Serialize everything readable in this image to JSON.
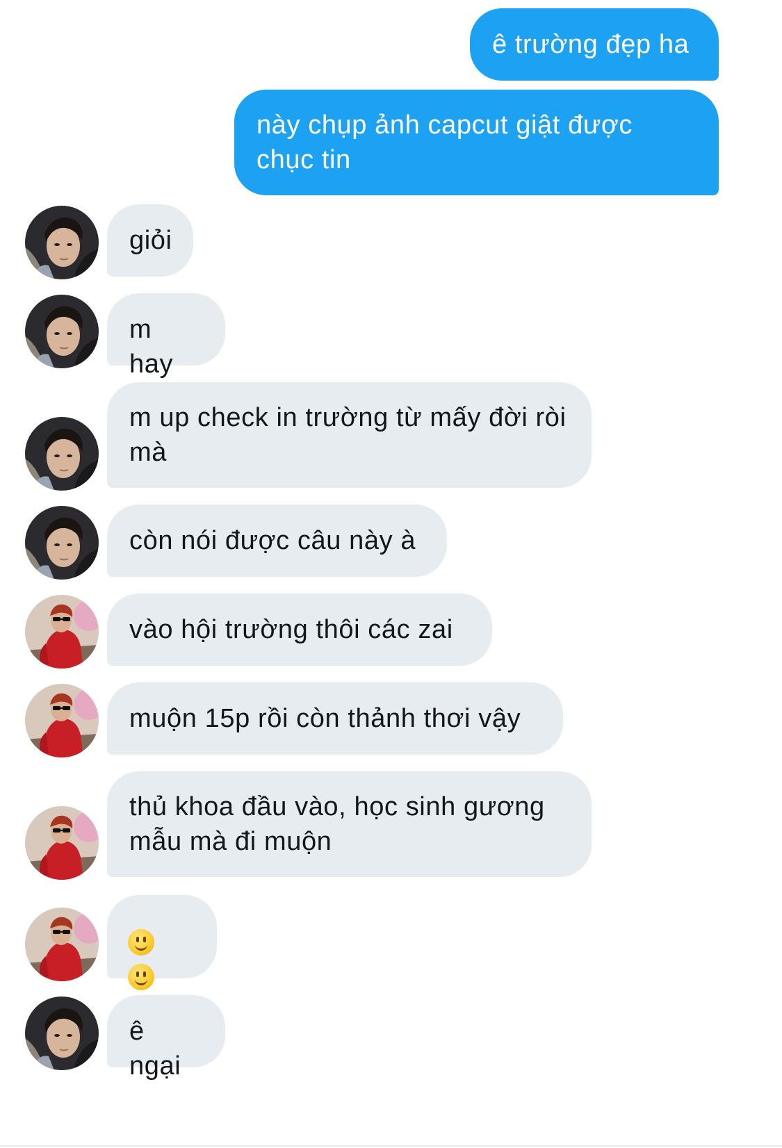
{
  "colors": {
    "outgoing_bubble": "#1da1f2",
    "incoming_bubble": "#e6ecf0",
    "outgoing_text": "#ffffff",
    "incoming_text": "#14171a"
  },
  "messages": [
    {
      "direction": "outgoing",
      "text": "ê trường đẹp ha"
    },
    {
      "direction": "outgoing",
      "text": "này chụp ảnh capcut giật được chục tin"
    },
    {
      "direction": "incoming",
      "sender_avatar": "avatar-person-a",
      "text": "giỏi"
    },
    {
      "direction": "incoming",
      "sender_avatar": "avatar-person-a",
      "text": "m hay"
    },
    {
      "direction": "incoming",
      "sender_avatar": "avatar-person-a",
      "text": "m up check in trường từ mấy đời ròi mà"
    },
    {
      "direction": "incoming",
      "sender_avatar": "avatar-person-a",
      "text": "còn nói được câu này à"
    },
    {
      "direction": "incoming",
      "sender_avatar": "avatar-person-b",
      "text": "vào hội trường thôi các zai"
    },
    {
      "direction": "incoming",
      "sender_avatar": "avatar-person-b",
      "text": "muộn 15p rồi còn thảnh thơi vậy"
    },
    {
      "direction": "incoming",
      "sender_avatar": "avatar-person-b",
      "text": "thủ khoa đầu vào, học sinh gương mẫu mà đi muộn"
    },
    {
      "direction": "incoming",
      "sender_avatar": "avatar-person-b",
      "emoji": [
        "slightly-smiling-face-icon",
        "slightly-smiling-face-icon"
      ]
    },
    {
      "direction": "incoming",
      "sender_avatar": "avatar-person-a",
      "text": "ê ngại"
    }
  ]
}
